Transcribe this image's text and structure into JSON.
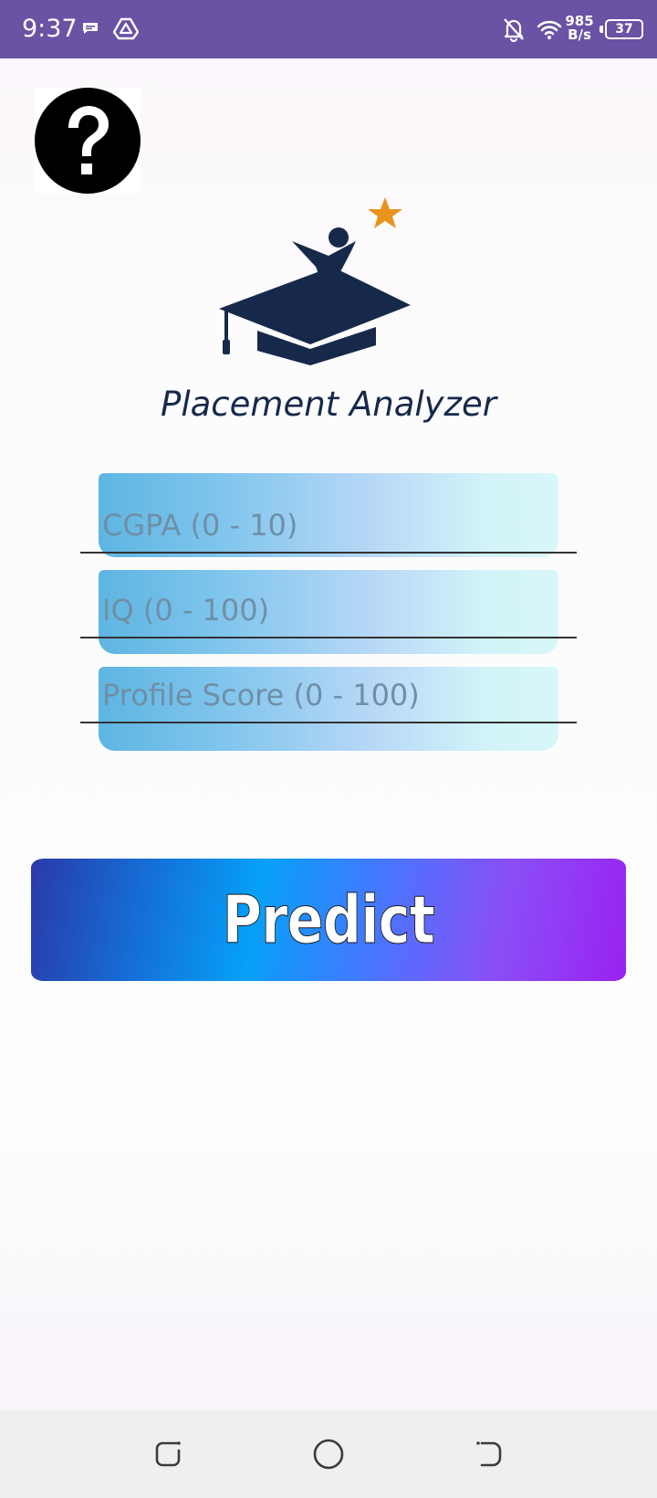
{
  "status_bar": {
    "time": "9:37",
    "net_speed_value": "985",
    "net_speed_unit": "B/s",
    "battery_level": "37",
    "background_color": "#6a52a4",
    "icons": [
      "message-icon",
      "drive-icon",
      "bell-off-icon",
      "wifi-icon",
      "battery-icon"
    ]
  },
  "app": {
    "title": "Placement Analyzer",
    "logo_icon": "graduate-cap-star-icon",
    "help_icon": "question-mark-icon"
  },
  "form": {
    "cgpa": {
      "placeholder": "CGPA (0 - 10)",
      "value": ""
    },
    "iq": {
      "placeholder": "IQ (0 - 100)",
      "value": ""
    },
    "profile_score": {
      "placeholder": "Profile Score (0 - 100)",
      "value": ""
    },
    "predict_label": "Predict"
  },
  "nav_bar": {
    "items": [
      "recent-apps-icon",
      "home-icon",
      "back-icon"
    ]
  }
}
